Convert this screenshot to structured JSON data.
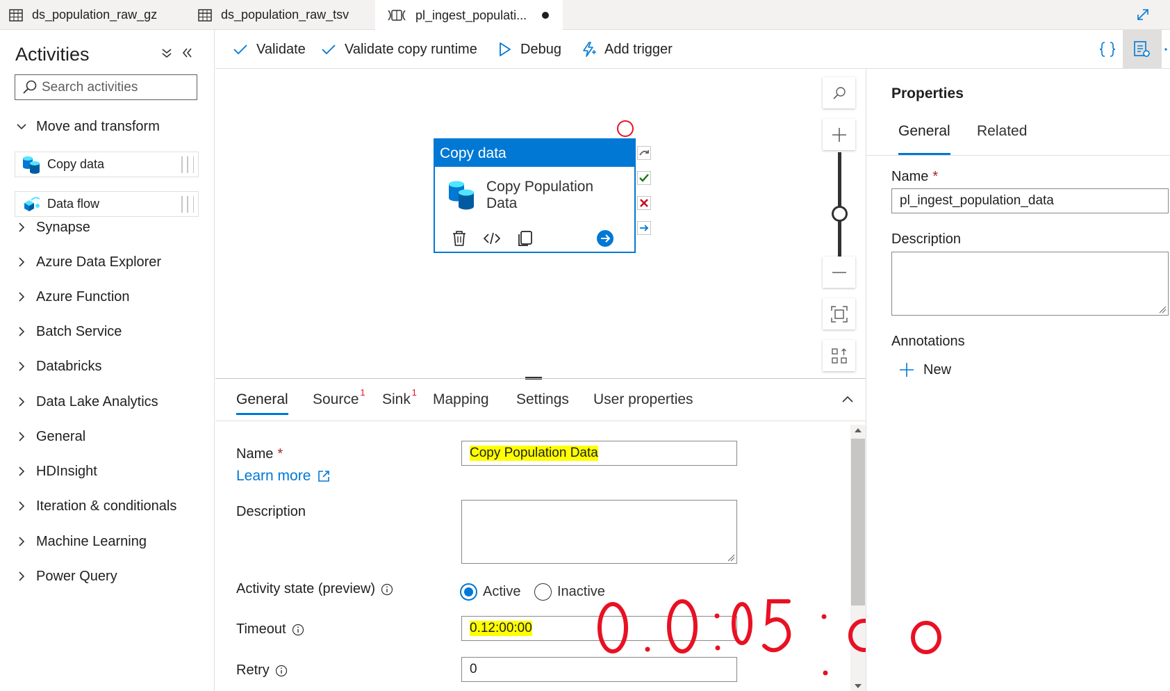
{
  "tabs": [
    {
      "label": "ds_population_raw_gz",
      "icon": "table-icon"
    },
    {
      "label": "ds_population_raw_tsv",
      "icon": "table-icon"
    },
    {
      "label": "pl_ingest_populati...",
      "icon": "pipeline-icon",
      "active": true,
      "unsaved": true
    }
  ],
  "activities": {
    "title": "Activities",
    "search_placeholder": "Search activities",
    "expanded_category": "Move and transform",
    "items": [
      "Copy data",
      "Data flow"
    ],
    "categories": [
      "Synapse",
      "Azure Data Explorer",
      "Azure Function",
      "Batch Service",
      "Databricks",
      "Data Lake Analytics",
      "General",
      "HDInsight",
      "Iteration & conditionals",
      "Machine Learning",
      "Power Query"
    ]
  },
  "toolbar": {
    "validate": "Validate",
    "validate_copy_runtime": "Validate copy runtime",
    "debug": "Debug",
    "add_trigger": "Add trigger"
  },
  "node": {
    "header": "Copy data",
    "name_line1": "Copy Population",
    "name_line2": "Data"
  },
  "bottom": {
    "tabs": [
      {
        "label": "General",
        "active": true,
        "badge": ""
      },
      {
        "label": "Source",
        "badge": "1"
      },
      {
        "label": "Sink",
        "badge": "1"
      },
      {
        "label": "Mapping",
        "badge": ""
      },
      {
        "label": "Settings",
        "badge": ""
      },
      {
        "label": "User properties",
        "badge": ""
      }
    ],
    "name_label": "Name",
    "required_mark": "*",
    "learn_more": "Learn more",
    "name_value": "Copy Population Data",
    "description_label": "Description",
    "activity_state_label": "Activity state (preview)",
    "state_active": "Active",
    "state_inactive": "Inactive",
    "timeout_label": "Timeout",
    "timeout_value": "0.12:00:00",
    "retry_label": "Retry",
    "retry_value": "0",
    "annotation_text": "0.0:05:00"
  },
  "properties": {
    "title": "Properties",
    "tab_general": "General",
    "tab_related": "Related",
    "name_label": "Name",
    "name_value": "pl_ingest_population_data",
    "description_label": "Description",
    "annotations_label": "Annotations",
    "new_label": "New"
  },
  "colors": {
    "accent": "#0078d4",
    "highlight": "#ffff00",
    "annotation_red": "#e81123"
  }
}
